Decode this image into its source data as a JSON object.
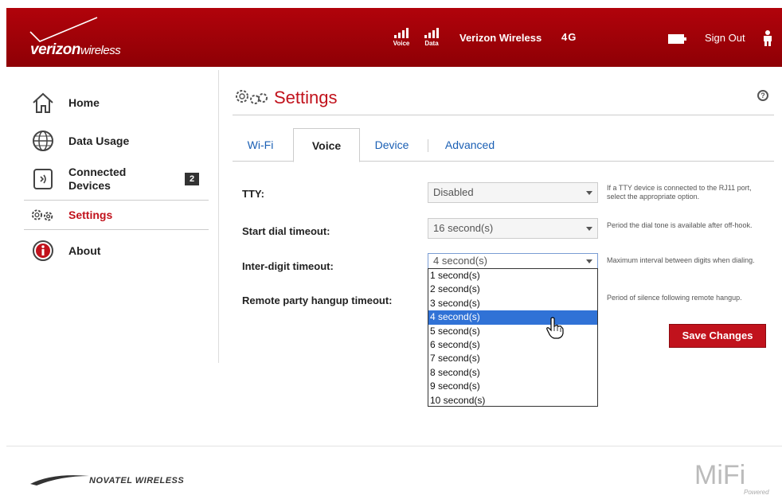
{
  "header": {
    "logo_bold": "verizon",
    "logo_light": "wireless",
    "signal_voice_label": "Voice",
    "signal_data_label": "Data",
    "carrier": "Verizon Wireless",
    "network": "4G",
    "sign_out": "Sign Out"
  },
  "sidebar": {
    "items": [
      {
        "label": "Home"
      },
      {
        "label": "Data Usage"
      },
      {
        "label": "Connected Devices",
        "badge": "2"
      },
      {
        "label": "Settings"
      },
      {
        "label": "About"
      }
    ]
  },
  "main": {
    "title": "Settings",
    "tabs": [
      {
        "label": "Wi-Fi"
      },
      {
        "label": "Voice"
      },
      {
        "label": "Device"
      },
      {
        "label": "Advanced"
      }
    ],
    "fields": [
      {
        "label": "TTY:",
        "value": "Disabled",
        "help": "If a TTY device is connected to the RJ11 port, select the appropriate option."
      },
      {
        "label": "Start dial timeout:",
        "value": "16 second(s)",
        "help": "Period the dial tone is available after off-hook."
      },
      {
        "label": "Inter-digit timeout:",
        "value": "4 second(s)",
        "help": "Maximum interval between digits when dialing."
      },
      {
        "label": "Remote party hangup timeout:",
        "value": "",
        "help": "Period of silence following remote hangup."
      }
    ],
    "dropdown_options": [
      "1 second(s)",
      "2 second(s)",
      "3 second(s)",
      "4 second(s)",
      "5 second(s)",
      "6 second(s)",
      "7 second(s)",
      "8 second(s)",
      "9 second(s)",
      "10 second(s)"
    ],
    "save_button": "Save Changes"
  },
  "footer": {
    "brand": "NOVATEL WIRELESS",
    "product": "MiFi",
    "product_sub": "Powered"
  },
  "colors": {
    "brand_red": "#c1121c",
    "header_red": "#a00209",
    "link_blue": "#1a5fb4",
    "highlight_blue": "#3072d6"
  }
}
